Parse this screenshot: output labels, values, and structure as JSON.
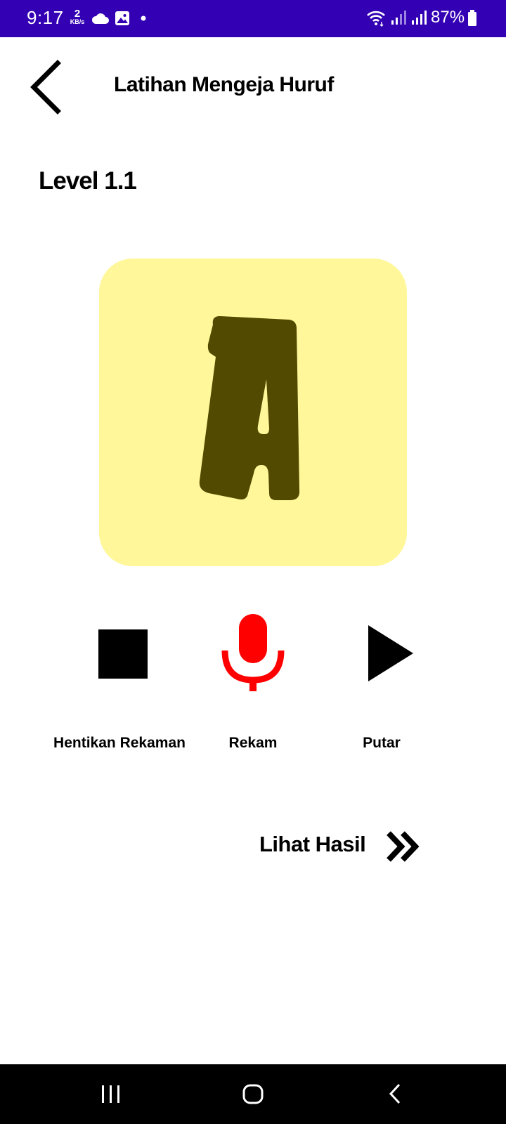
{
  "status_bar": {
    "time": "9:17",
    "network_speed_value": "2",
    "network_speed_unit": "KB/s",
    "battery_percent": "87%",
    "background_color": "#3300b4",
    "icons": [
      "cloud-icon",
      "gallery-icon",
      "notification-dot-icon",
      "wifi-icon",
      "signal-icon",
      "signal-icon",
      "battery-icon"
    ]
  },
  "app_bar": {
    "title": "Latihan Mengeja Huruf",
    "back_icon": "chevron-left-icon"
  },
  "level": {
    "label": "Level 1.1"
  },
  "letter_card": {
    "letter": "A",
    "background_color": "#fff79a",
    "letter_color": "#524a00"
  },
  "controls": {
    "stop": {
      "label": "Hentikan Rekaman",
      "icon": "stop-icon"
    },
    "record": {
      "label": "Rekam",
      "icon": "microphone-icon",
      "color": "#ff0000"
    },
    "play": {
      "label": "Putar",
      "icon": "play-icon"
    }
  },
  "result_link": {
    "label": "Lihat Hasil",
    "icon": "double-chevron-right-icon"
  },
  "nav_bar": {
    "recents_icon": "recents-icon",
    "home_icon": "home-icon",
    "back_icon": "back-icon"
  }
}
